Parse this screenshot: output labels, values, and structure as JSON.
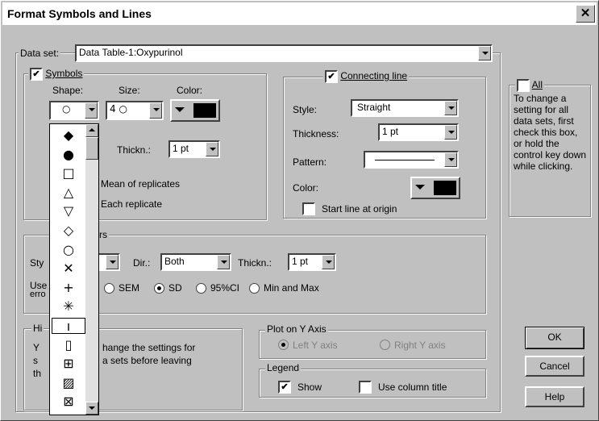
{
  "window": {
    "title": "Format Symbols and Lines"
  },
  "dataset": {
    "label": "Data set:",
    "value": "Data Table-1:Oxypurinol"
  },
  "symbols": {
    "group_label": "Symbols",
    "checked": true,
    "shape_label": "Shape:",
    "size_label": "Size:",
    "color_label": "Color:",
    "shape_value": "○",
    "size_value": "4 ○",
    "thickn_label": "Thickn.:",
    "thickn_value": "1 pt",
    "mean_label": "Mean of replicates",
    "each_label": "Each replicate",
    "color_swatch": "#000000"
  },
  "shape_list": {
    "items": [
      "◆",
      "●",
      "□",
      "△",
      "▽",
      "◇",
      "○",
      "✕",
      "+",
      "✳",
      "ı",
      "▯",
      "⊞",
      "▨",
      "⊠"
    ],
    "selected_index": 10
  },
  "connecting_line": {
    "group_label": "Connecting line",
    "checked": true,
    "style_label": "Style:",
    "style_value": "Straight",
    "thickness_label": "Thickness:",
    "thickness_value": "1 pt",
    "pattern_label": "Pattern:",
    "color_label": "Color:",
    "color_swatch": "#000000",
    "start_label": "Start line at origin",
    "start_checked": false
  },
  "all": {
    "label": "All",
    "checked": false,
    "help": "To change a setting for all data sets, first check this box, or hold the control key down while clicking."
  },
  "error_bars": {
    "group_label_fragment": "rs",
    "style_label_fragment": "Sty",
    "dir_label": "Dir.:",
    "dir_value": "Both",
    "thickn_label": "Thickn.:",
    "thickn_value": "1 pt",
    "use_fragment1": "Use",
    "use_fragment2": "erro",
    "opt_sem": "SEM",
    "opt_sd": "SD",
    "opt_ci": "95%CI",
    "opt_minmax": "Min and Max",
    "selected": "SD"
  },
  "hint": {
    "label_fragment": "Hi",
    "line1_a": "Y",
    "line1_b": "hange the settings for",
    "line2_a": "s",
    "line2_b": "a sets before leaving",
    "line3_a": "th"
  },
  "plot_on": {
    "group_label": "Plot on Y Axis",
    "left": "Left Y axis",
    "right": "Right  Y axis",
    "selected": "left"
  },
  "legend": {
    "group_label": "Legend",
    "show_label": "Show",
    "show_checked": true,
    "use_col_label": "Use column title",
    "use_col_checked": false
  },
  "buttons": {
    "ok": "OK",
    "cancel": "Cancel",
    "help": "Help"
  }
}
